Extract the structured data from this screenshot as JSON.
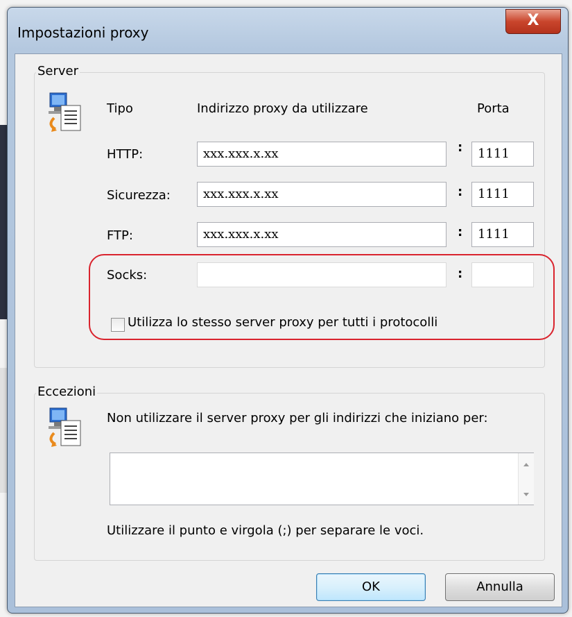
{
  "window": {
    "title": "Impostazioni proxy",
    "close_label": "X"
  },
  "server": {
    "group_label": "Server",
    "headers": {
      "type": "Tipo",
      "address": "Indirizzo proxy da utilizzare",
      "port": "Porta"
    },
    "rows": [
      {
        "label": "HTTP:",
        "address": "xxx.xxx.x.xx",
        "colon": ":",
        "port": "1111"
      },
      {
        "label": "Sicurezza:",
        "address": "xxx.xxx.x.xx",
        "colon": ":",
        "port": "1111"
      },
      {
        "label": "FTP:",
        "address": "xxx.xxx.x.xx",
        "colon": ":",
        "port": "1111"
      },
      {
        "label": "Socks:",
        "address": "",
        "colon": ":",
        "port": ""
      }
    ],
    "same_proxy_label": "Utilizza lo stesso server proxy per tutti i protocolli",
    "same_proxy_checked": false
  },
  "exceptions": {
    "group_label": "Eccezioni",
    "description": "Non utilizzare il server proxy per gli indirizzi che iniziano per:",
    "value": "",
    "hint": "Utilizzare il punto e virgola (;) per separare le voci."
  },
  "buttons": {
    "ok": "OK",
    "cancel": "Annulla"
  },
  "colors": {
    "highlight": "#d9232d",
    "default_button_border": "#3c7fb1"
  }
}
